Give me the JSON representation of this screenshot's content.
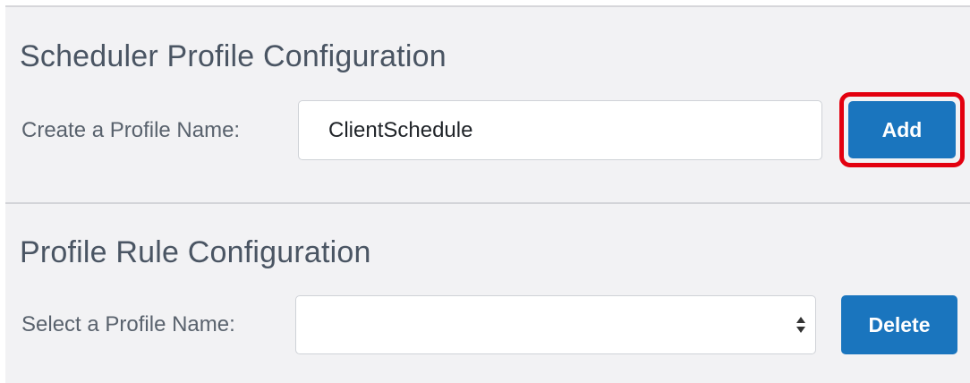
{
  "scheduler_section": {
    "title": "Scheduler Profile Configuration",
    "create_label": "Create a Profile Name:",
    "profile_name_value": "ClientSchedule",
    "add_button_label": "Add"
  },
  "rule_section": {
    "title": "Profile Rule Configuration",
    "select_label": "Select a Profile Name:",
    "selected_value": "",
    "delete_button_label": "Delete"
  },
  "icons": {
    "select_arrows": "up-down-caret-icon"
  },
  "colors": {
    "primary_button": "#1a75be",
    "highlight": "#e3000f",
    "panel_background": "#f2f2f4",
    "title_text": "#4a5563"
  }
}
